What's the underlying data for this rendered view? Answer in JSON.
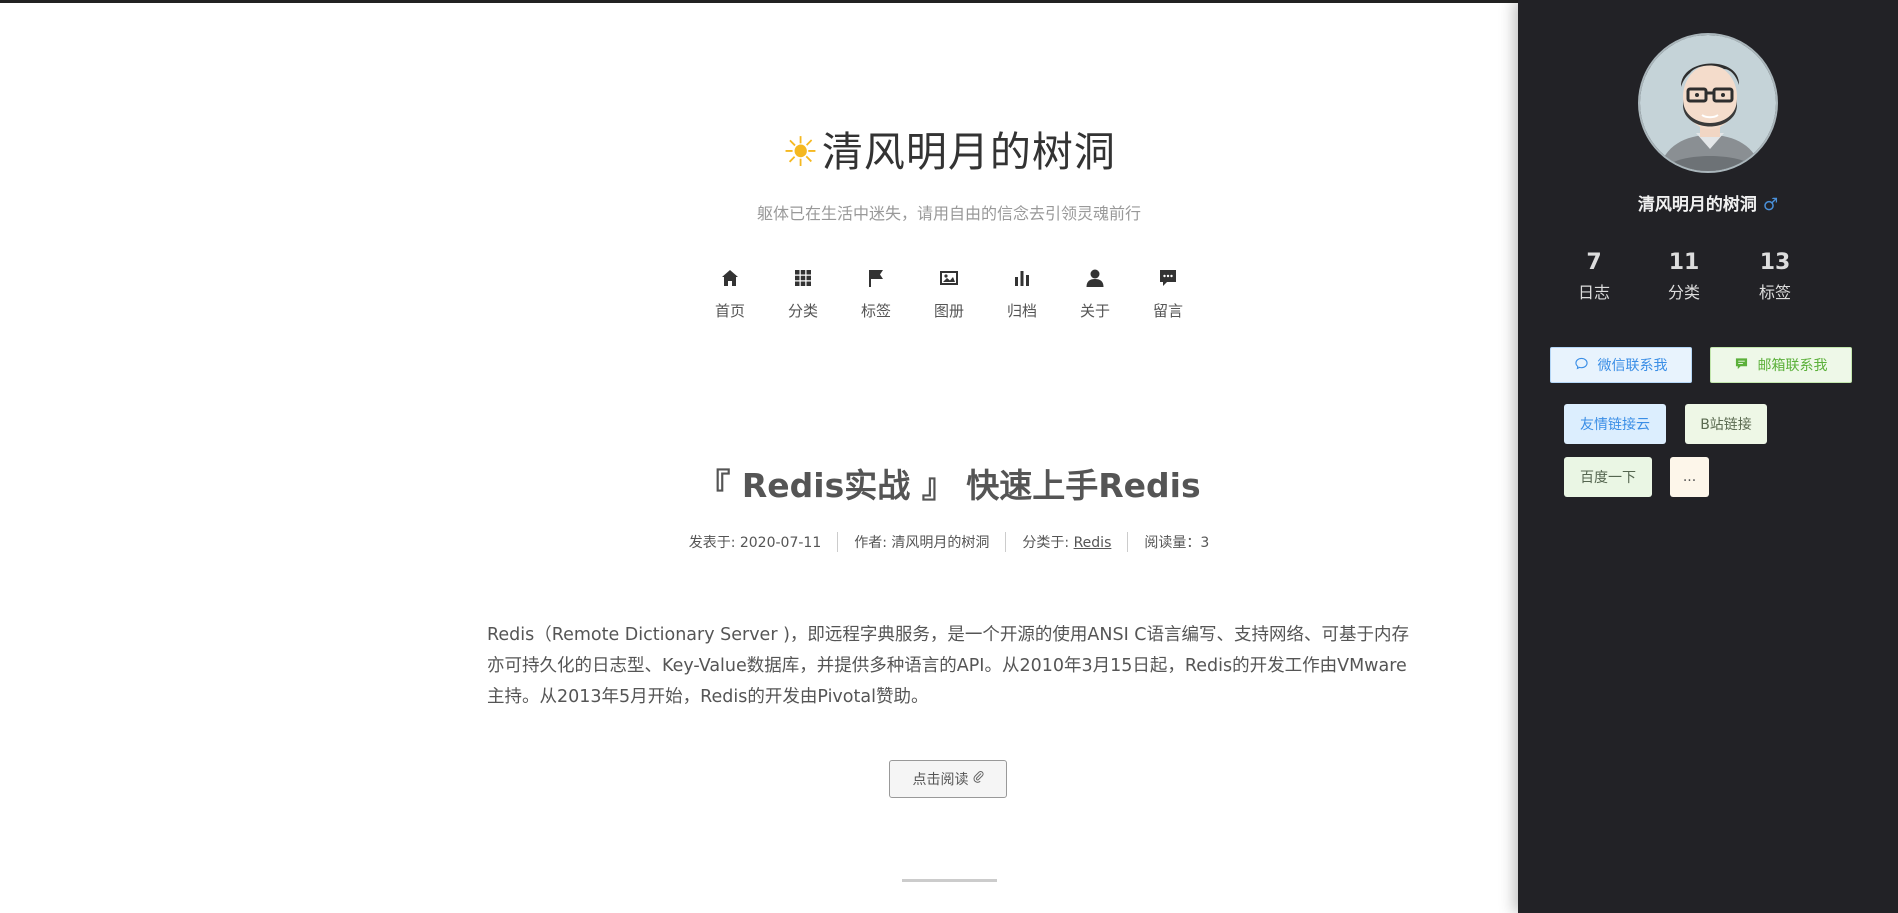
{
  "site": {
    "title": "清风明月的树洞",
    "sun_glyph": "☀",
    "subtitle": "躯体已在生活中迷失，请用自由的信念去引领灵魂前行"
  },
  "nav": [
    {
      "label": "首页",
      "icon": "home-icon"
    },
    {
      "label": "分类",
      "icon": "grid-icon"
    },
    {
      "label": "标签",
      "icon": "flag-icon"
    },
    {
      "label": "图册",
      "icon": "image-icon"
    },
    {
      "label": "归档",
      "icon": "bar-chart-icon"
    },
    {
      "label": "关于",
      "icon": "user-icon"
    },
    {
      "label": "留言",
      "icon": "comment-icon"
    }
  ],
  "post": {
    "title": "『 Redis实战 』 快速上手Redis",
    "meta": {
      "published": "发表于: 2020-07-11",
      "author": "作者: 清风明月的树洞",
      "category_prefix": "分类于: ",
      "category": "Redis",
      "views": "阅读量：3"
    },
    "excerpt": "Redis（Remote Dictionary Server )，即远程字典服务，是一个开源的使用ANSI C语言编写、支持网络、可基于内存亦可持久化的日志型、Key-Value数据库，并提供多种语言的API。从2010年3月15日起，Redis的开发工作由VMware主持。从2013年5月开始，Redis的开发由Pivotal赞助。",
    "read_more": "点击阅读",
    "read_more_icon": "paperclip-icon"
  },
  "sidebar": {
    "author": "清风明月的树洞",
    "gender_glyph": "♂",
    "stats": [
      {
        "num": "7",
        "label": "日志"
      },
      {
        "num": "11",
        "label": "分类"
      },
      {
        "num": "13",
        "label": "标签"
      }
    ],
    "contacts": [
      {
        "label": "微信联系我",
        "icon": "wechat-icon",
        "color": "#3a8ee6"
      },
      {
        "label": "邮箱联系我",
        "icon": "message-icon",
        "color": "#5bb03a"
      }
    ],
    "links": [
      "友情链接云",
      "B站链接",
      "百度一下",
      "..."
    ]
  },
  "colors": {
    "sidebar_bg": "#222226",
    "accent_sun": "#f5b820",
    "gender_blue": "#4a90d9"
  }
}
